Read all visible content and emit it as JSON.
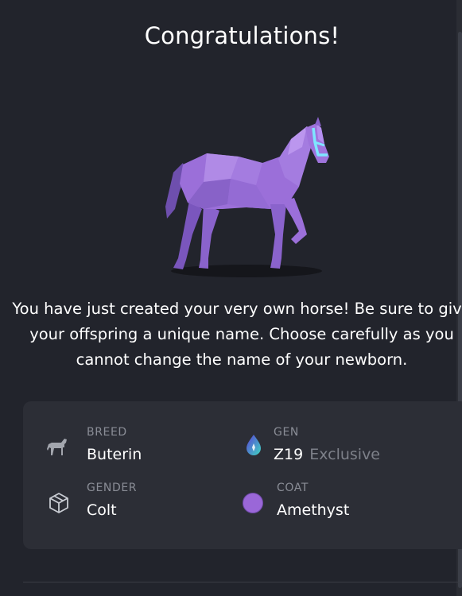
{
  "modal": {
    "title": "Congratulations!",
    "description": "You have just created your very own horse! Be sure to give your offspring a unique name. Choose carefully as you cannot change the name of your newborn.",
    "horse_art": {
      "subject": "horse",
      "color": "#9b6fd9",
      "halter_color": "#7ee6ff"
    }
  },
  "info": {
    "breed": {
      "label": "BREED",
      "value": "Buterin",
      "icon": "horse-icon"
    },
    "gen": {
      "label": "GEN",
      "value": "Z19",
      "extra": "Exclusive",
      "icon": "gen-drop-icon"
    },
    "gender": {
      "label": "GENDER",
      "value": "Colt",
      "icon": "cube-icon"
    },
    "coat": {
      "label": "COAT",
      "value": "Amethyst",
      "color": "#9a67d8",
      "icon": "coat-swatch"
    }
  }
}
